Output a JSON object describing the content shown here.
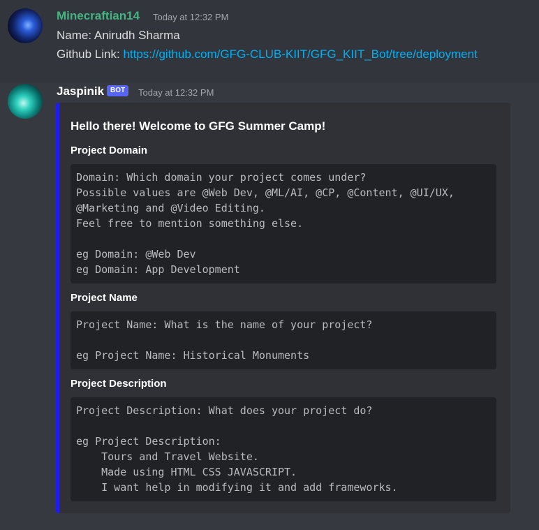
{
  "messages": [
    {
      "username": "Minecraftian14",
      "timestamp": "Today at 12:32 PM",
      "name_line": "Name: Anirudh Sharma",
      "github_prefix": "Github Link: ",
      "github_url": "https://github.com/GFG-CLUB-KIIT/GFG_KIIT_Bot/tree/deployment"
    },
    {
      "username": "Jaspinik",
      "badge": "BOT",
      "timestamp": "Today at 12:32 PM"
    }
  ],
  "embed": {
    "title": "Hello there! Welcome to GFG Summer Camp!",
    "accent_color": "#1d1ded",
    "fields": [
      {
        "name": "Project Domain",
        "value": "Domain: Which domain your project comes under?\nPossible values are @Web Dev, @ML/AI, @CP, @Content, @UI/UX,\n@Marketing and @Video Editing.\nFeel free to mention something else.\n\neg Domain: @Web Dev\neg Domain: App Development"
      },
      {
        "name": "Project Name",
        "value": "Project Name: What is the name of your project?\n\neg Project Name: Historical Monuments"
      },
      {
        "name": "Project Description",
        "value": "Project Description: What does your project do?\n\neg Project Description:\n    Tours and Travel Website.\n    Made using HTML CSS JAVASCRIPT.\n    I want help in modifying it and add frameworks."
      }
    ]
  },
  "colors": {
    "background": "#36393f",
    "hover_message": "#32353b",
    "username_green": "#43b581",
    "link": "#00b0f4",
    "bot_badge": "#5865f2",
    "code_bg": "#202225"
  }
}
